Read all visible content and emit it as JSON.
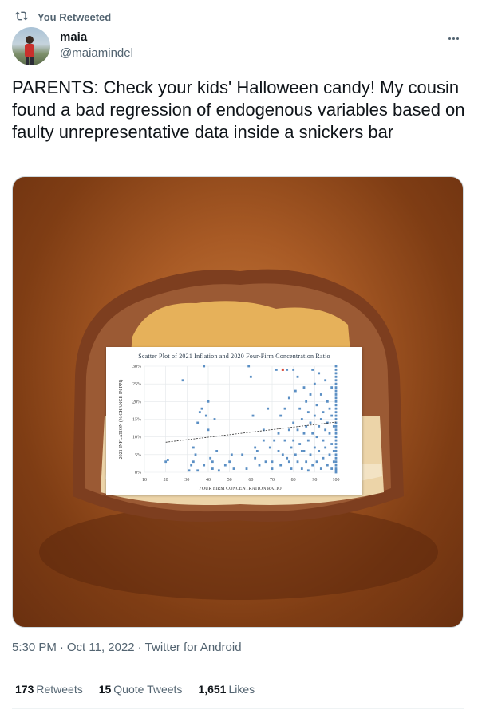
{
  "retweet_context": {
    "label": "You Retweeted",
    "icon": "retweet-icon"
  },
  "author": {
    "display_name": "maia",
    "handle": "@maiamindel",
    "avatar": "avatar"
  },
  "more_icon": "more-horizontal-icon",
  "tweet": {
    "text": "PARENTS: Check your kids' Halloween candy! My cousin found a bad regression of endogenous variables based on faulty unrepresentative data inside a snickers bar"
  },
  "media": {
    "description_icon": "candy-bar-photo",
    "chart_data": {
      "type": "scatter",
      "title": "Scatter Plot of 2021 Inflation and 2020 Four-Firm Concentration Ratio",
      "xlabel": "Four Firm Concentration Ratio",
      "ylabel": "2021 Inflation (% Change in PPI)",
      "xlim": [
        10,
        100
      ],
      "ylim": [
        0,
        30
      ],
      "xticks": [
        "10",
        "20",
        "30",
        "40",
        "50",
        "60",
        "70",
        "80",
        "90",
        "100"
      ],
      "yticks": [
        "0%",
        "5%",
        "10%",
        "15%",
        "20%",
        "25%",
        "30%"
      ],
      "trendline": {
        "x": [
          20,
          100
        ],
        "y": [
          8.5,
          14.2
        ]
      },
      "grid": true,
      "point_color": "#5b8fc4",
      "highlight_color": "#d94b3a",
      "points": [
        [
          20,
          3
        ],
        [
          21,
          3.5
        ],
        [
          28,
          26
        ],
        [
          31,
          0.5
        ],
        [
          32,
          2
        ],
        [
          33,
          3
        ],
        [
          33,
          7
        ],
        [
          34,
          5
        ],
        [
          35,
          14
        ],
        [
          35,
          0.5
        ],
        [
          36,
          17
        ],
        [
          37,
          18
        ],
        [
          38,
          30
        ],
        [
          38,
          2
        ],
        [
          39,
          16
        ],
        [
          40,
          20
        ],
        [
          40,
          12
        ],
        [
          41,
          4
        ],
        [
          42,
          3
        ],
        [
          42,
          1
        ],
        [
          43,
          15
        ],
        [
          45,
          0.5
        ],
        [
          48,
          2
        ],
        [
          50,
          3
        ],
        [
          51,
          5
        ],
        [
          52,
          1
        ],
        [
          58,
          1
        ],
        [
          59,
          30
        ],
        [
          60,
          27
        ],
        [
          61,
          16
        ],
        [
          62,
          7
        ],
        [
          62,
          4
        ],
        [
          63,
          6
        ],
        [
          64,
          2
        ],
        [
          66,
          12
        ],
        [
          67,
          3
        ],
        [
          68,
          18
        ],
        [
          69,
          7
        ],
        [
          70,
          1
        ],
        [
          70,
          3
        ],
        [
          71,
          9
        ],
        [
          72,
          29
        ],
        [
          73,
          6
        ],
        [
          73,
          11
        ],
        [
          74,
          2
        ],
        [
          75,
          5
        ],
        [
          76,
          18
        ],
        [
          76,
          9
        ],
        [
          77,
          29
        ],
        [
          77,
          4
        ],
        [
          78,
          21
        ],
        [
          78,
          12
        ],
        [
          79,
          7
        ],
        [
          79,
          1
        ],
        [
          80,
          29
        ],
        [
          80,
          14
        ],
        [
          80,
          9
        ],
        [
          81,
          23
        ],
        [
          81,
          5
        ],
        [
          82,
          27
        ],
        [
          82,
          12
        ],
        [
          82,
          3
        ],
        [
          83,
          18
        ],
        [
          83,
          8
        ],
        [
          84,
          15
        ],
        [
          84,
          1
        ],
        [
          85,
          24
        ],
        [
          85,
          11
        ],
        [
          85,
          6
        ],
        [
          86,
          20
        ],
        [
          86,
          13
        ],
        [
          86,
          3
        ],
        [
          87,
          17
        ],
        [
          87,
          9
        ],
        [
          87,
          0.5
        ],
        [
          88,
          22
        ],
        [
          88,
          14
        ],
        [
          88,
          5
        ],
        [
          89,
          29
        ],
        [
          89,
          11
        ],
        [
          89,
          2
        ],
        [
          90,
          25
        ],
        [
          90,
          16
        ],
        [
          90,
          7
        ],
        [
          91,
          19
        ],
        [
          91,
          10
        ],
        [
          91,
          3
        ],
        [
          92,
          28
        ],
        [
          92,
          13
        ],
        [
          92,
          6
        ],
        [
          93,
          22
        ],
        [
          93,
          15
        ],
        [
          93,
          1
        ],
        [
          94,
          17
        ],
        [
          94,
          9
        ],
        [
          94,
          4
        ],
        [
          95,
          26
        ],
        [
          95,
          12
        ],
        [
          95,
          7
        ],
        [
          96,
          20
        ],
        [
          96,
          14
        ],
        [
          96,
          2
        ],
        [
          97,
          18
        ],
        [
          97,
          11
        ],
        [
          97,
          5
        ],
        [
          98,
          24
        ],
        [
          98,
          16
        ],
        [
          98,
          8
        ],
        [
          98,
          1
        ],
        [
          99,
          13
        ],
        [
          99,
          6
        ],
        [
          99,
          3
        ],
        [
          100,
          30
        ],
        [
          100,
          29
        ],
        [
          100,
          28
        ],
        [
          100,
          27
        ],
        [
          100,
          26
        ],
        [
          100,
          25
        ],
        [
          100,
          24
        ],
        [
          100,
          23
        ],
        [
          100,
          22
        ],
        [
          100,
          21
        ],
        [
          100,
          20
        ],
        [
          100,
          19
        ],
        [
          100,
          18
        ],
        [
          100,
          17
        ],
        [
          100,
          16
        ],
        [
          100,
          15
        ],
        [
          100,
          14
        ],
        [
          100,
          13
        ],
        [
          100,
          12
        ],
        [
          100,
          11
        ],
        [
          100,
          10
        ],
        [
          100,
          9
        ],
        [
          100,
          8
        ],
        [
          100,
          7
        ],
        [
          100,
          6
        ],
        [
          100,
          5
        ],
        [
          100,
          4
        ],
        [
          100,
          3
        ],
        [
          100,
          2
        ],
        [
          100,
          1
        ],
        [
          100,
          0.5
        ],
        [
          100,
          0
        ],
        [
          74,
          16
        ],
        [
          84,
          6
        ],
        [
          66,
          9
        ],
        [
          56,
          5
        ],
        [
          44,
          6
        ],
        [
          78,
          3
        ]
      ],
      "highlight_points": [
        [
          75,
          29
        ]
      ]
    }
  },
  "timestamp": {
    "time": "5:30 PM",
    "sep1": "·",
    "date": "Oct 11, 2022",
    "sep2": "·",
    "source": "Twitter for Android"
  },
  "stats": {
    "retweets": {
      "count": "173",
      "label": "Retweets"
    },
    "quote_tweets": {
      "count": "15",
      "label": "Quote Tweets"
    },
    "likes": {
      "count": "1,651",
      "label": "Likes"
    }
  }
}
